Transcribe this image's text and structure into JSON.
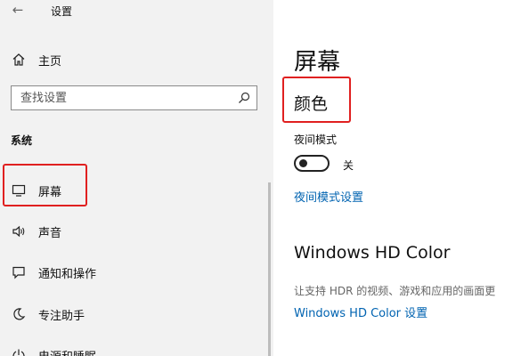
{
  "window": {
    "title": "设置"
  },
  "sidebar": {
    "home_label": "主页",
    "search_placeholder": "查找设置",
    "section_label": "系统",
    "items": [
      {
        "label": "屏幕",
        "icon": "monitor-icon"
      },
      {
        "label": "声音",
        "icon": "speaker-icon"
      },
      {
        "label": "通知和操作",
        "icon": "message-icon"
      },
      {
        "label": "专注助手",
        "icon": "moon-icon"
      },
      {
        "label": "电源和睡眠",
        "icon": "power-icon"
      }
    ]
  },
  "main": {
    "page_title": "屏幕",
    "color_section_title": "颜色",
    "night_light_label": "夜间模式",
    "night_light_state": "关",
    "night_light_on": false,
    "night_light_settings_link": "夜间模式设置",
    "hd_color_title": "Windows HD Color",
    "hd_color_desc": "让支持 HDR 的视频、游戏和应用的画面更",
    "hd_color_link": "Windows HD Color 设置"
  },
  "colors": {
    "sidebar_bg": "#f2f2f2",
    "accent_link": "#0063b1",
    "highlight_box": "#e02020"
  }
}
